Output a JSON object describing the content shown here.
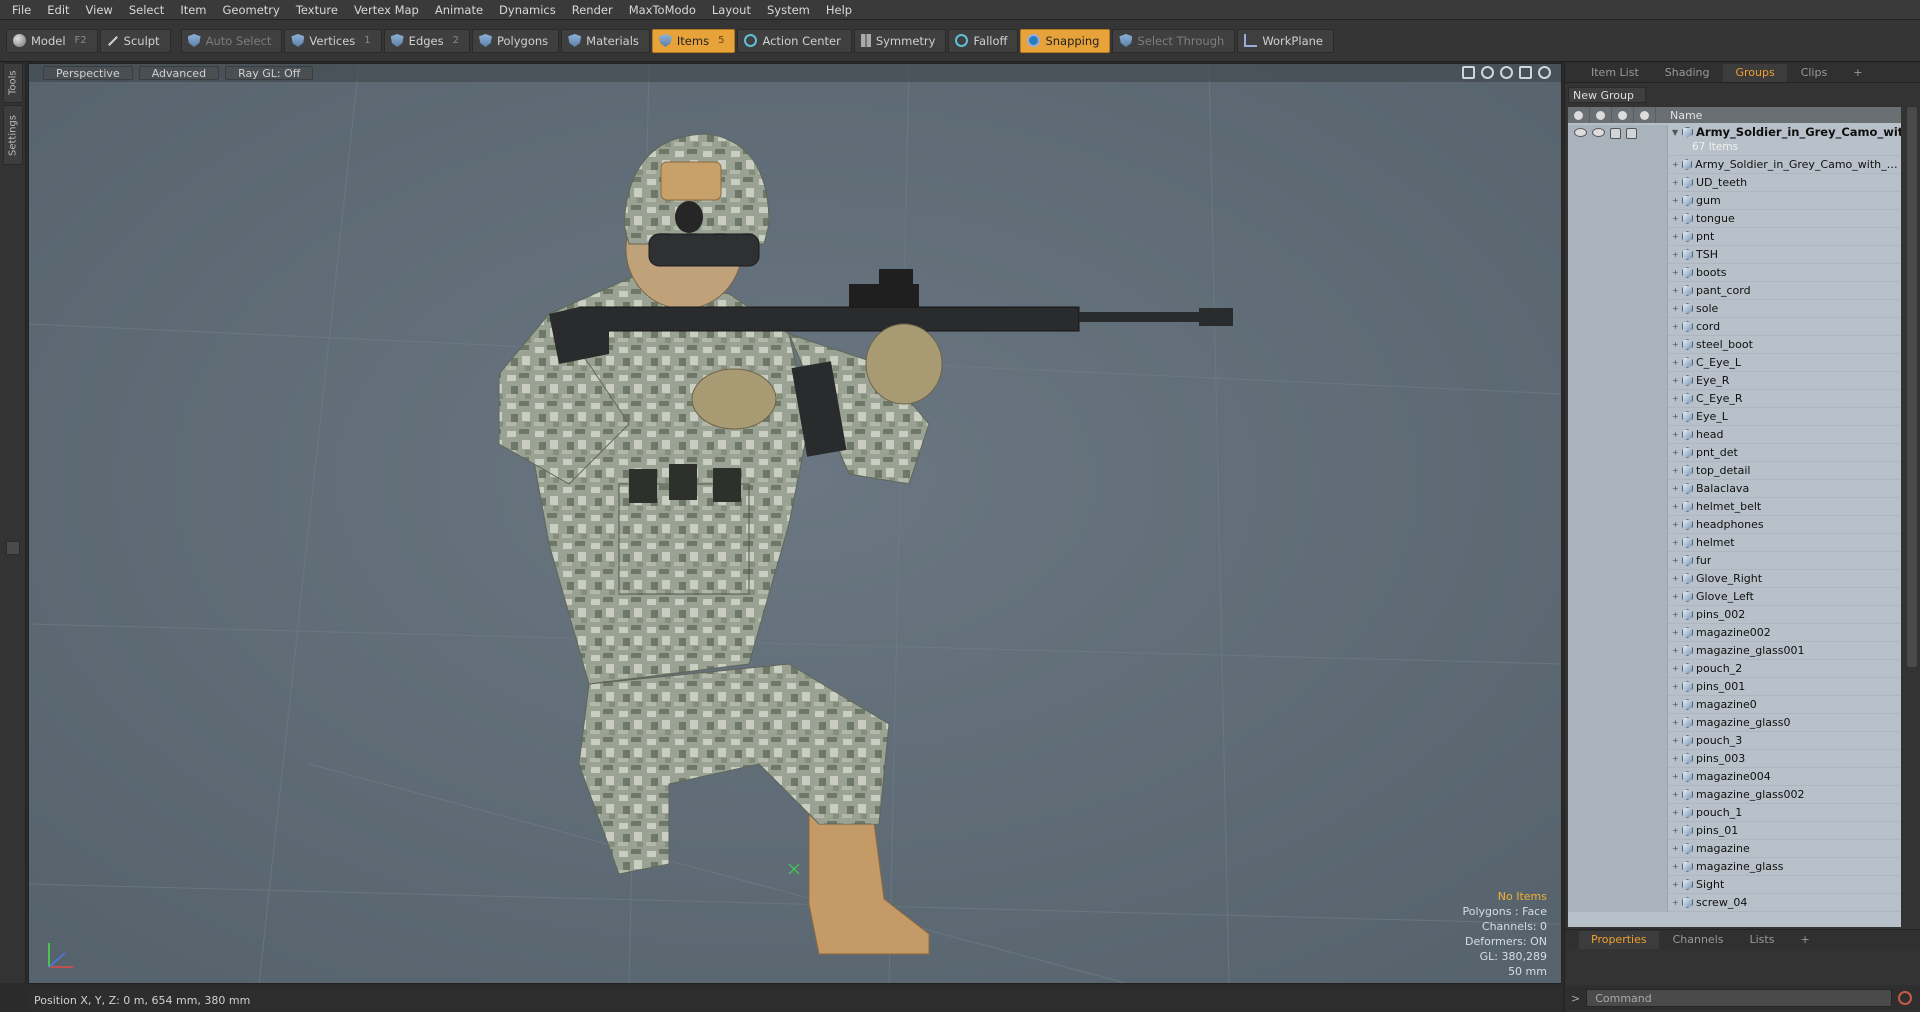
{
  "menu": [
    "File",
    "Edit",
    "View",
    "Select",
    "Item",
    "Geometry",
    "Texture",
    "Vertex Map",
    "Animate",
    "Dynamics",
    "Render",
    "MaxToModo",
    "Layout",
    "System",
    "Help"
  ],
  "toolbar": {
    "model": "Model",
    "model_key": "F2",
    "sculpt": "Sculpt",
    "auto_select": "Auto Select",
    "vertices": "Vertices",
    "vertices_key": "1",
    "edges": "Edges",
    "edges_key": "2",
    "polygons": "Polygons",
    "materials": "Materials",
    "items": "Items",
    "items_key": "5",
    "action_center": "Action Center",
    "symmetry": "Symmetry",
    "falloff": "Falloff",
    "snapping": "Snapping",
    "select_through": "Select Through",
    "workplane": "WorkPlane"
  },
  "left_tabs": [
    "Tools",
    "Settings"
  ],
  "viewport": {
    "view": "Perspective",
    "style": "Advanced",
    "raygl": "Ray GL: Off",
    "info": {
      "selection": "No Items",
      "polygons": "Polygons : Face",
      "channels": "Channels: 0",
      "deformers": "Deformers: ON",
      "gl": "GL: 380,289",
      "lens": "50 mm"
    }
  },
  "right_panel": {
    "tabs": [
      "Item List",
      "Shading",
      "Groups",
      "Clips",
      "+"
    ],
    "active_tab": "Groups",
    "new_group": "New Group",
    "column_name": "Name",
    "root": {
      "title": "Army_Soldier_in_Grey_Camo_wit ...",
      "count": "67 Items"
    },
    "items": [
      "Army_Soldier_in_Grey_Camo_with_Go...",
      "UD_teeth",
      "gum",
      "tongue",
      "pnt",
      "TSH",
      "boots",
      "pant_cord",
      "sole",
      "cord",
      "steel_boot",
      "C_Eye_L",
      "Eye_R",
      "C_Eye_R",
      "Eye_L",
      "head",
      "pnt_det",
      "top_detail",
      "Balaclava",
      "helmet_belt",
      "headphones",
      "helmet",
      "fur",
      "Glove_Right",
      "Glove_Left",
      "pins_002",
      "magazine002",
      "magazine_glass001",
      "pouch_2",
      "pins_001",
      "magazine0",
      "magazine_glass0",
      "pouch_3",
      "pins_003",
      "magazine004",
      "magazine_glass002",
      "pouch_1",
      "pins_01",
      "magazine",
      "magazine_glass",
      "Sight",
      "screw_04"
    ],
    "bottom_tabs": [
      "Properties",
      "Channels",
      "Lists",
      "+"
    ],
    "command_placeholder": "Command"
  },
  "status": {
    "position": "Position X, Y, Z:   0 m, 654 mm, 380 mm"
  },
  "colors": {
    "accent": "#e8a23a",
    "viewport_bg": "#5f6d78",
    "list_bg": "#b8c1c9"
  }
}
